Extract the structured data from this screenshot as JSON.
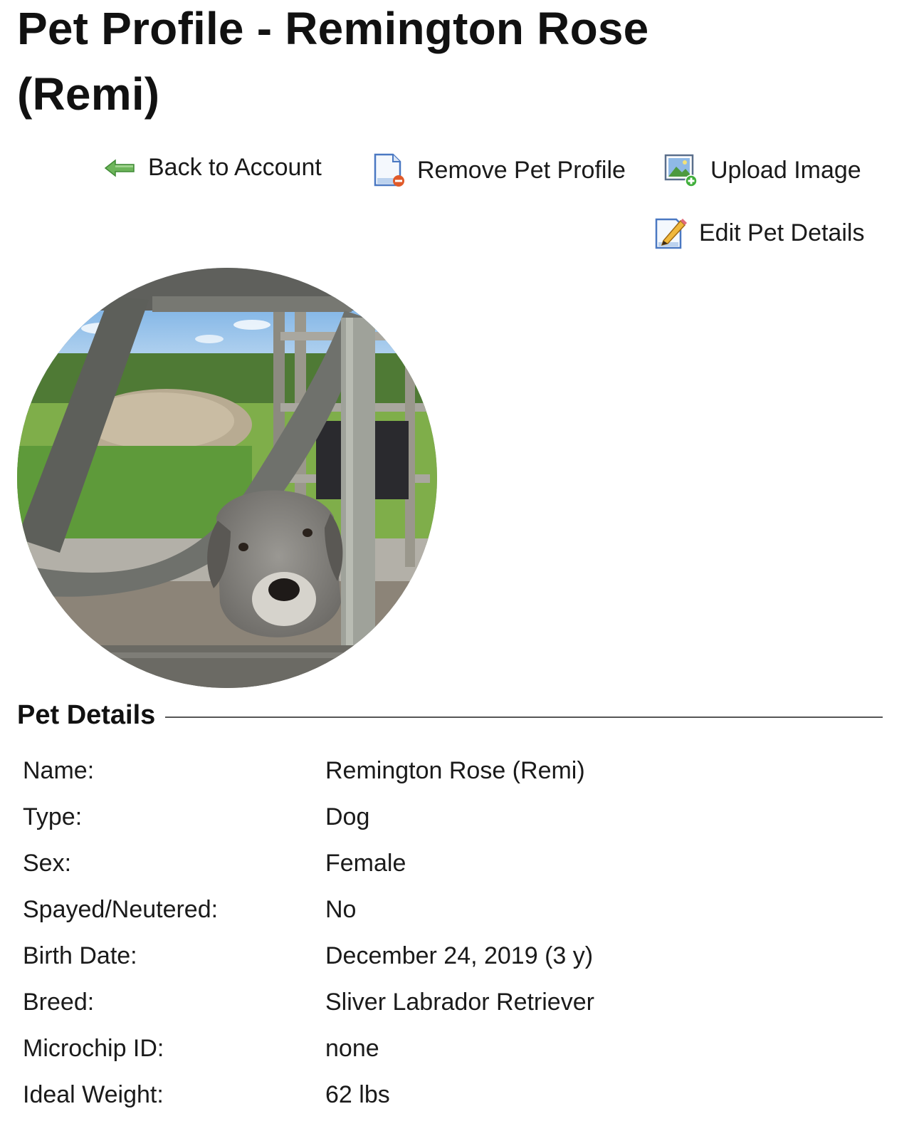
{
  "page": {
    "title": "Pet Profile - Remington Rose (Remi)"
  },
  "actions": {
    "back": {
      "label": "Back to Account",
      "icon": "arrow-left-icon"
    },
    "remove": {
      "label": "Remove Pet Profile",
      "icon": "document-remove-icon"
    },
    "upload": {
      "label": "Upload Image",
      "icon": "image-add-icon"
    },
    "edit": {
      "label": "Edit Pet Details",
      "icon": "pencil-edit-icon"
    }
  },
  "photo": {
    "description_icon": "pet-photo"
  },
  "details": {
    "heading": "Pet Details",
    "rows": [
      {
        "label": "Name:",
        "value": "Remington Rose (Remi)"
      },
      {
        "label": "Type:",
        "value": "Dog"
      },
      {
        "label": "Sex:",
        "value": "Female"
      },
      {
        "label": "Spayed/Neutered:",
        "value": "No"
      },
      {
        "label": "Birth Date:",
        "value": "December 24, 2019 (3 y)"
      },
      {
        "label": "Breed:",
        "value": "Sliver Labrador Retriever"
      },
      {
        "label": "Microchip ID:",
        "value": "none"
      },
      {
        "label": "Ideal Weight:",
        "value": "62 lbs"
      }
    ]
  },
  "colors": {
    "arrow_green": "#5aa34a",
    "remove_red": "#e05a2a",
    "doc_blue": "#4a78c2"
  }
}
